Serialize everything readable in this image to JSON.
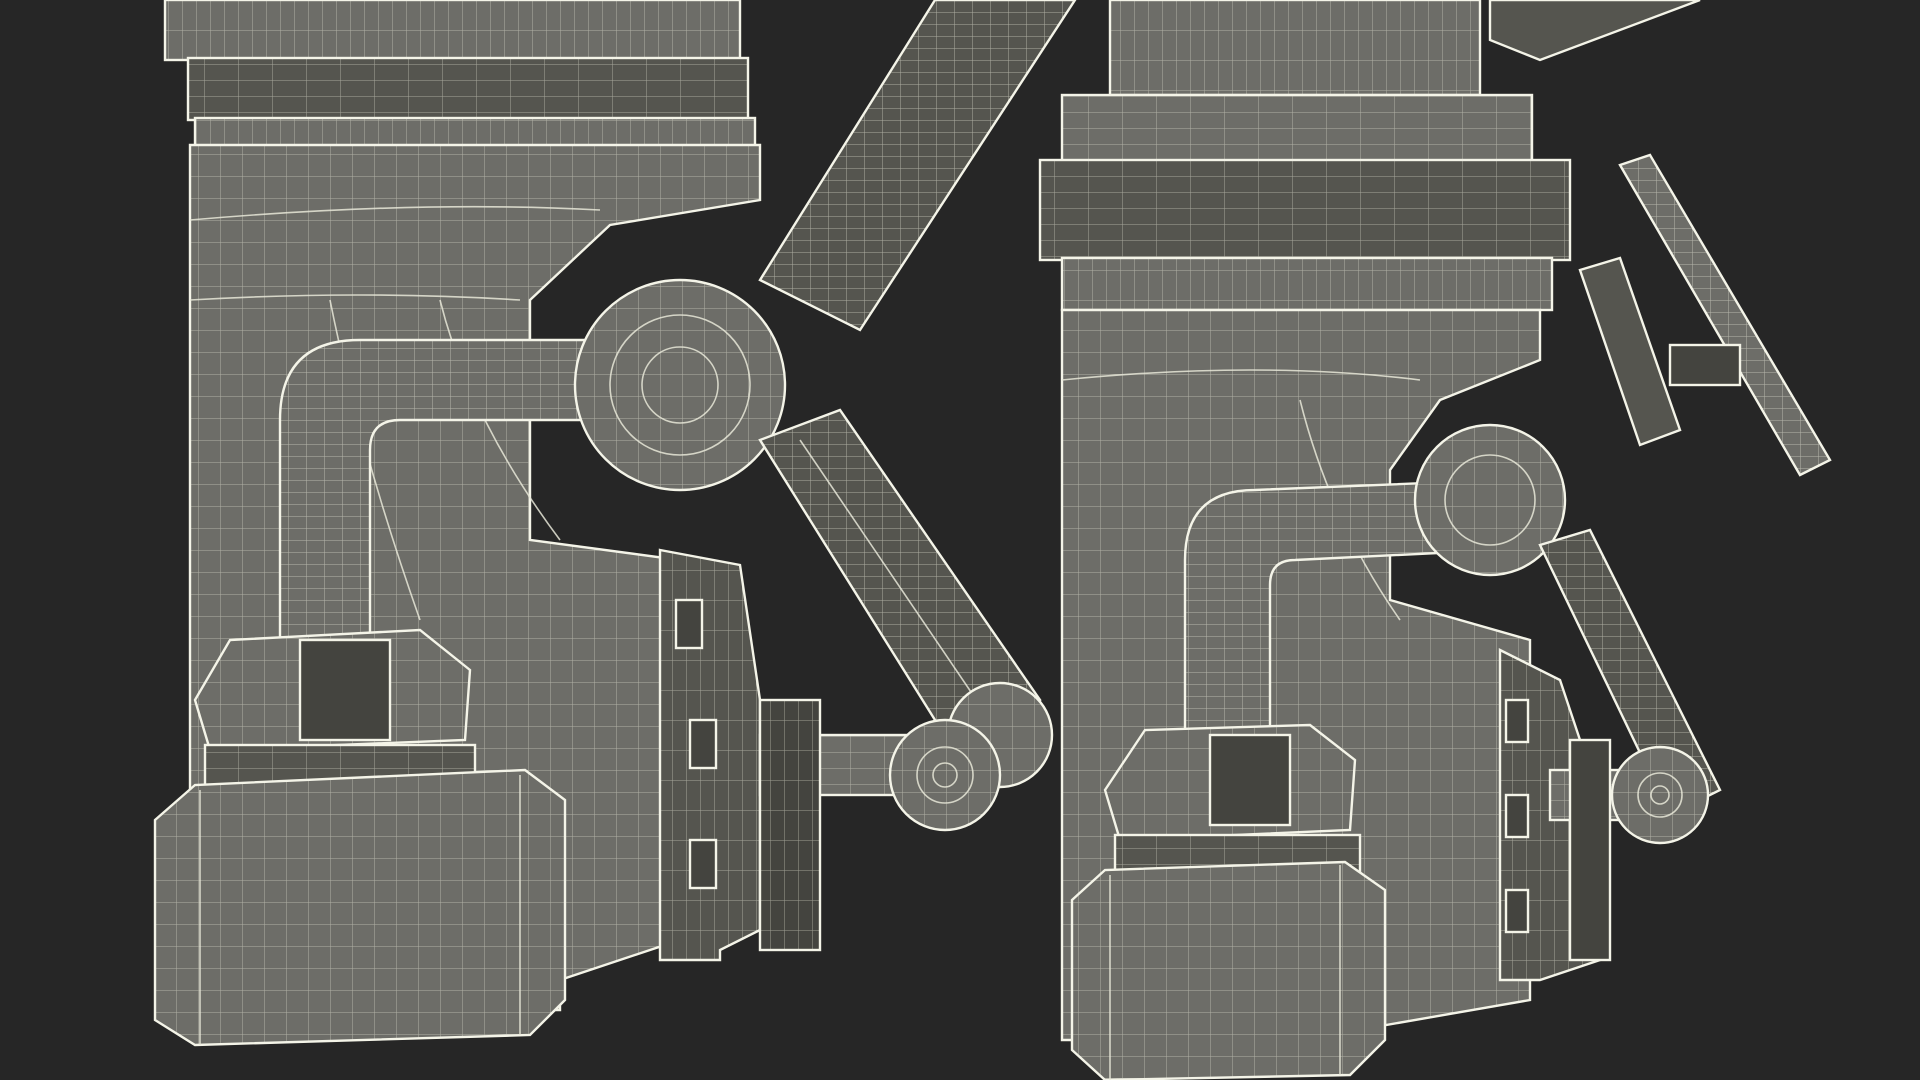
{
  "render": {
    "background_color": "#262626",
    "surface_color": "#6d6d68",
    "surface_shade_color": "#55554f",
    "surface_dark_color": "#44443f",
    "wire_color": "#e8e8d8"
  },
  "subjects": {
    "left_unit": {
      "name": "left-mechanical-leg"
    },
    "right_unit": {
      "name": "right-mechanical-leg"
    }
  }
}
